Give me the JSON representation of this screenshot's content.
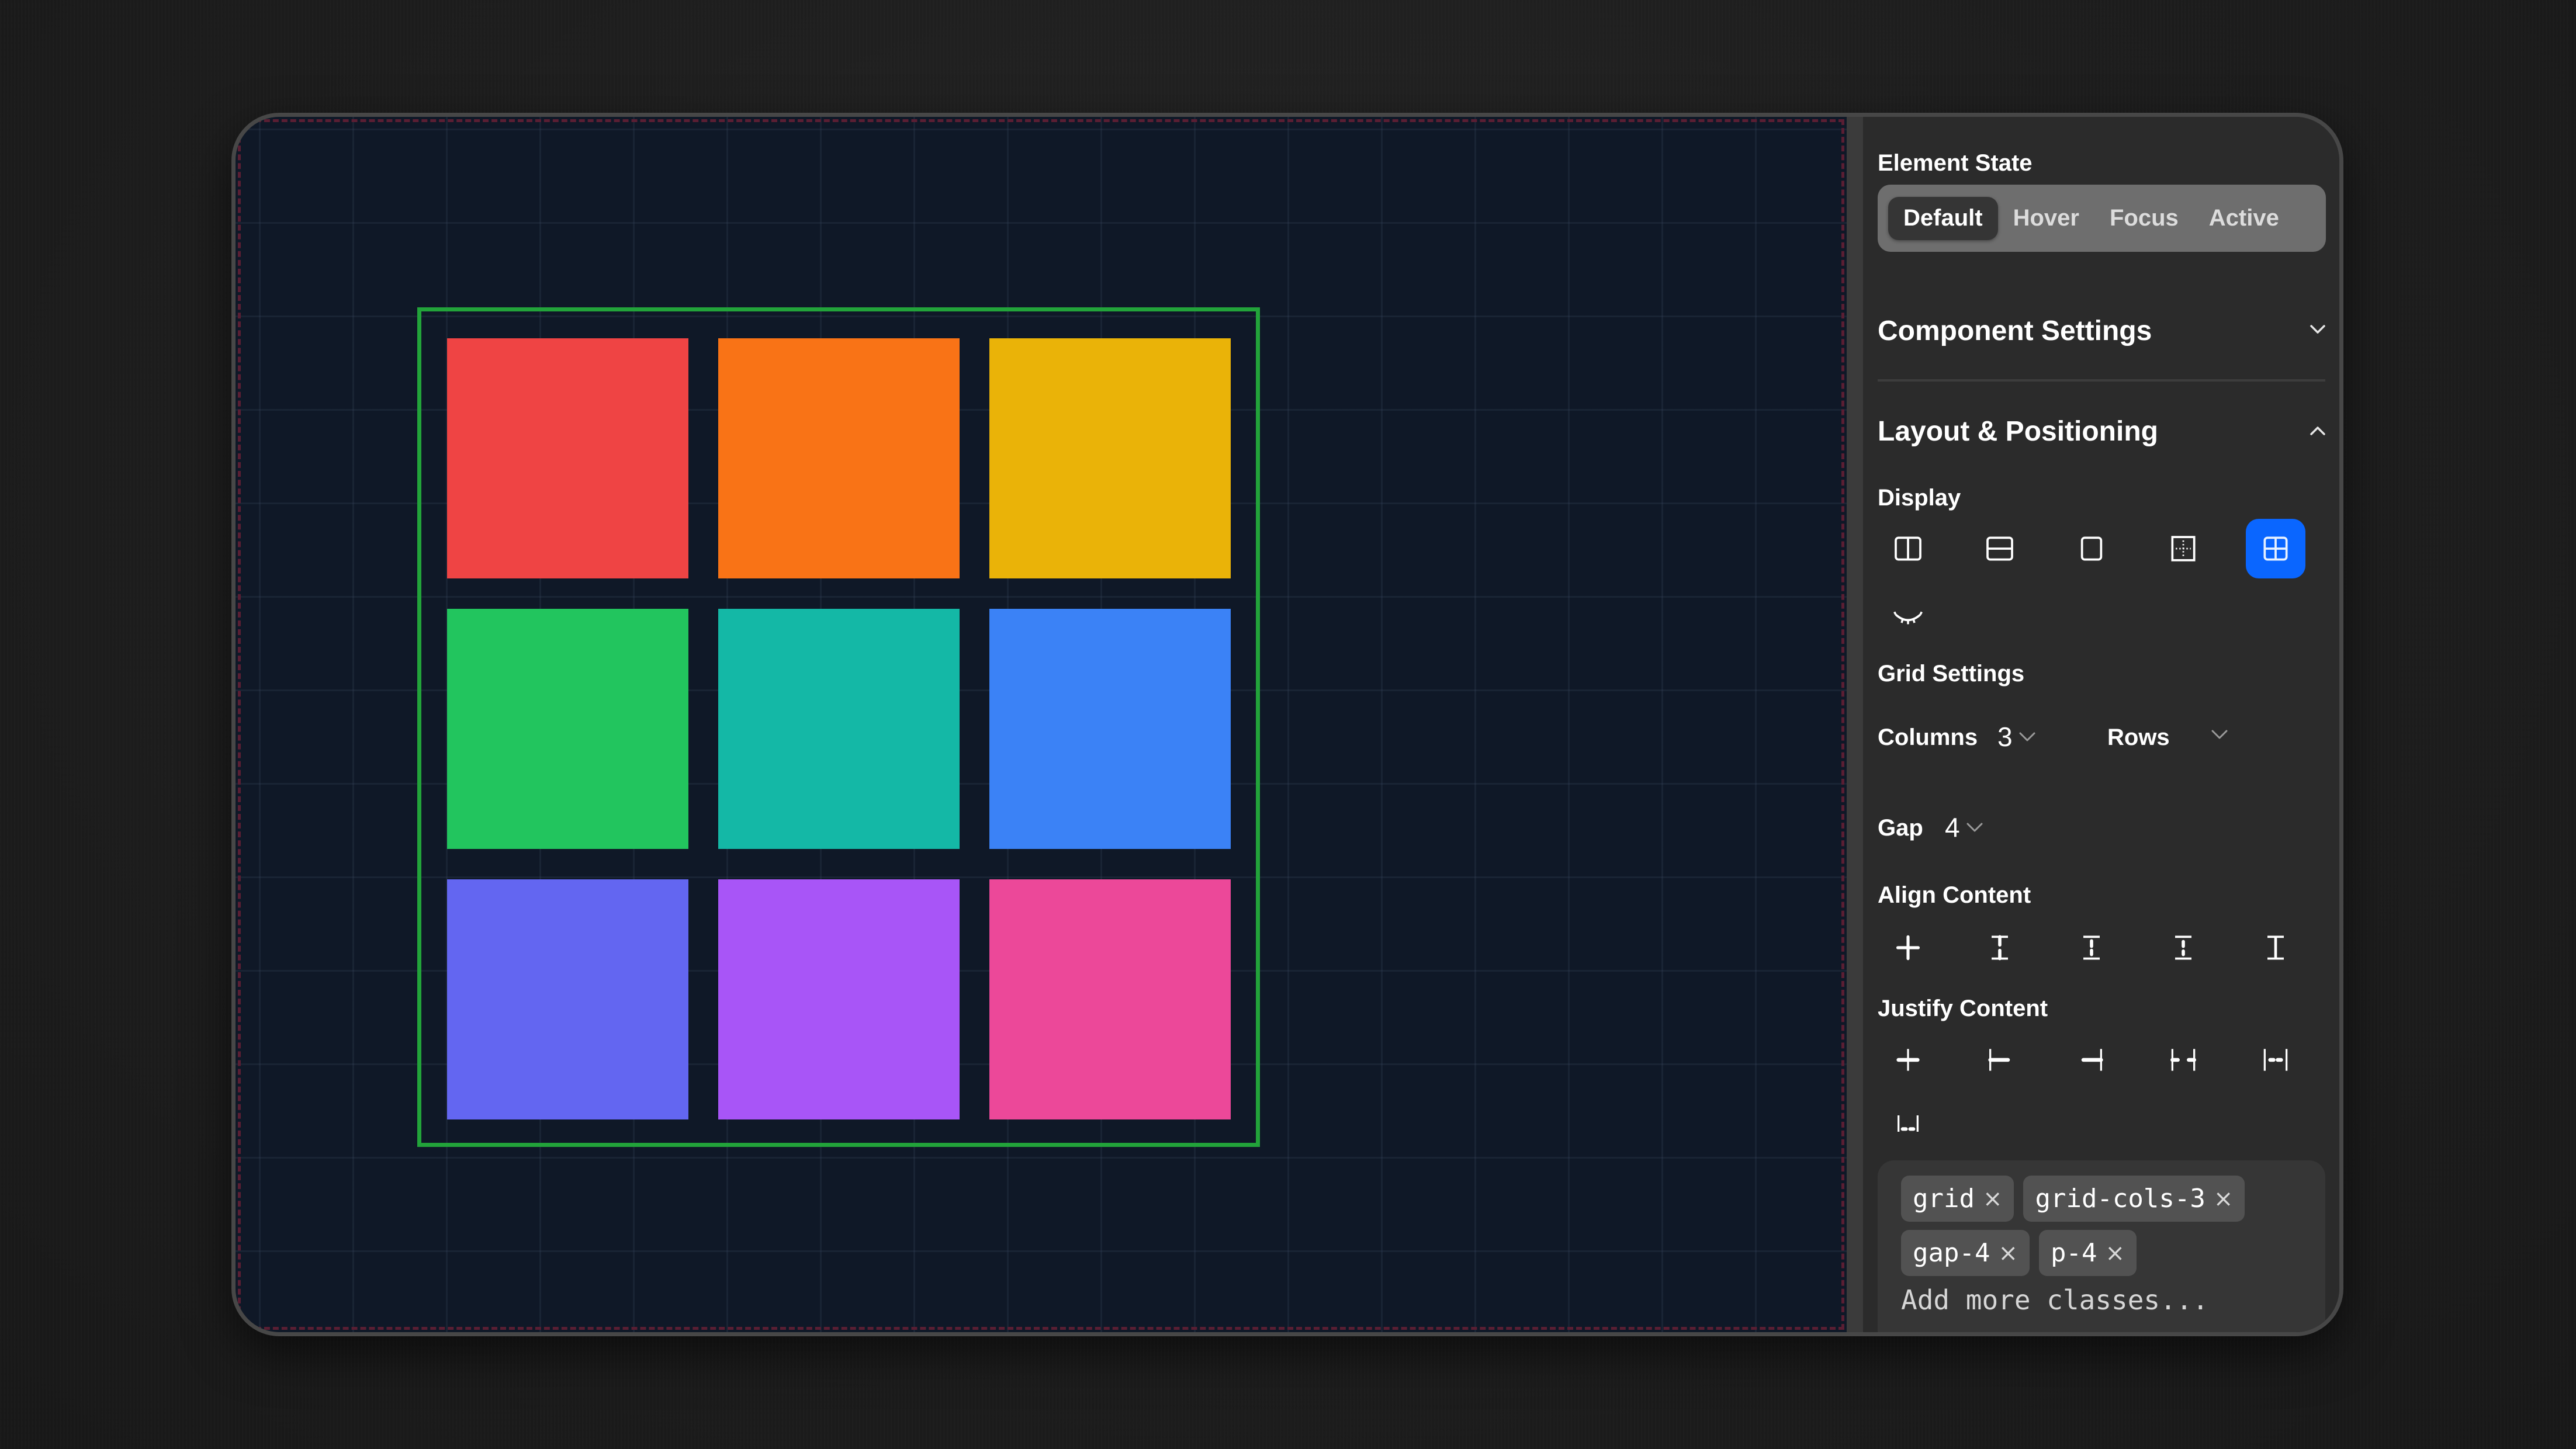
{
  "canvas": {
    "background": "#0f1827",
    "frame_color": "#22a33a",
    "grid_items": [
      {
        "name": "red",
        "color": "#ef4444"
      },
      {
        "name": "orange",
        "color": "#f97316"
      },
      {
        "name": "yellow",
        "color": "#eab308"
      },
      {
        "name": "green",
        "color": "#22c55e"
      },
      {
        "name": "teal",
        "color": "#14b8a6"
      },
      {
        "name": "blue",
        "color": "#3b82f6"
      },
      {
        "name": "indigo",
        "color": "#6366f1"
      },
      {
        "name": "purple",
        "color": "#a855f7"
      },
      {
        "name": "pink",
        "color": "#ec4899"
      }
    ]
  },
  "panel": {
    "element_state": {
      "title": "Element State",
      "options": [
        "Default",
        "Hover",
        "Focus",
        "Active"
      ],
      "selected": "Default"
    },
    "component_settings": {
      "title": "Component Settings",
      "expanded": false,
      "chevron": "chevron-down-icon"
    },
    "layout_positioning": {
      "title": "Layout & Positioning",
      "expanded": true,
      "chevron": "chevron-up-icon",
      "display": {
        "label": "Display",
        "options": [
          {
            "icon": "columns-layout-icon",
            "value": "flex-row"
          },
          {
            "icon": "rows-layout-icon",
            "value": "flex-col"
          },
          {
            "icon": "block-icon",
            "value": "block"
          },
          {
            "icon": "inline-block-dotted-icon",
            "value": "inline-block"
          },
          {
            "icon": "grid-icon",
            "value": "grid"
          },
          {
            "icon": "eye-closed-icon",
            "value": "hidden"
          }
        ],
        "selected": "grid",
        "accent": "#0a66ff"
      },
      "grid_settings": {
        "label": "Grid Settings",
        "columns_label": "Columns",
        "columns_value": "3",
        "rows_label": "Rows",
        "rows_value": "",
        "gap_label": "Gap",
        "gap_value": "4"
      },
      "align_content": {
        "label": "Align Content",
        "options": [
          "align-center-icon",
          "align-start-icon",
          "align-between-icon",
          "align-around-icon",
          "align-stretch-icon"
        ]
      },
      "justify_content": {
        "label": "Justify Content",
        "options": [
          "justify-center-icon",
          "justify-start-icon",
          "justify-end-icon",
          "justify-between-icon",
          "justify-around-icon",
          "justify-evenly-icon"
        ]
      }
    },
    "classes": {
      "chips": [
        "grid",
        "grid-cols-3",
        "gap-4",
        "p-4"
      ],
      "remove_glyph": "×",
      "placeholder": "Add more classes..."
    }
  }
}
